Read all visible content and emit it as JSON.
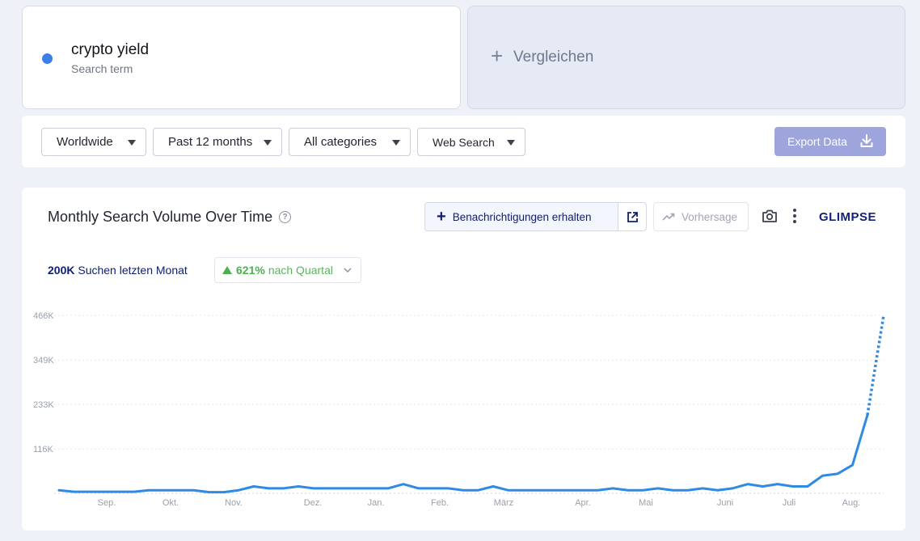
{
  "term": {
    "name": "crypto yield",
    "subtitle": "Search term",
    "color": "#3d7fe6"
  },
  "compare": {
    "label": "Vergleichen"
  },
  "filters": {
    "region": "Worldwide",
    "period": "Past 12 months",
    "category": "All categories",
    "source": "Web Search",
    "export_label": "Export Data"
  },
  "chart_panel": {
    "title": "Monthly Search Volume Over Time",
    "notify_label": "Benachrichtigungen erhalten",
    "forecast_label": "Vorhersage",
    "logo": "GLIMPSE",
    "stat_value": "200K",
    "stat_label": "Suchen letzten Monat",
    "growth_value": "621%",
    "growth_label": "nach Quartal"
  },
  "chart_data": {
    "type": "line",
    "y_ticks": [
      "466K",
      "349K",
      "233K",
      "116K"
    ],
    "y_tick_values": [
      466000,
      349000,
      233000,
      116000
    ],
    "x_ticks": [
      "Sep.",
      "Okt.",
      "Nov.",
      "Dez.",
      "Jan.",
      "Feb.",
      "März",
      "Apr.",
      "Mai",
      "Juni",
      "Juli",
      "Aug."
    ],
    "ylim": [
      0,
      466000
    ],
    "grid": true,
    "series": [
      {
        "color": "#2f8ae5",
        "values": [
          8000,
          4000,
          4000,
          4000,
          4000,
          4000,
          8000,
          8000,
          8000,
          8000,
          3000,
          3000,
          8000,
          18000,
          13000,
          13000,
          18000,
          13000,
          13000,
          13000,
          13000,
          13000,
          13000,
          24000,
          13000,
          13000,
          13000,
          8000,
          8000,
          18000,
          8000,
          8000,
          8000,
          8000,
          8000,
          8000,
          8000,
          13000,
          8000,
          8000,
          13000,
          8000,
          8000,
          13000,
          8000,
          13000,
          24000,
          18000,
          24000,
          18000,
          18000,
          46000,
          51000,
          74000,
          205000
        ],
        "forecast_values": [
          205000,
          466000
        ]
      }
    ]
  }
}
